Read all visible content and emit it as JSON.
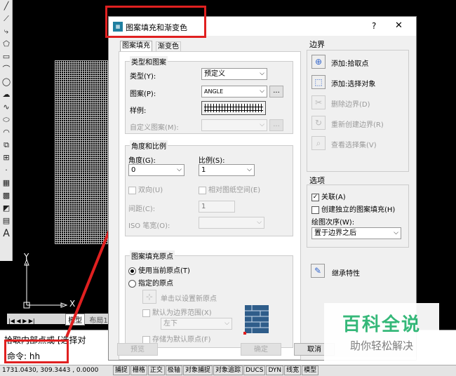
{
  "dialog": {
    "title": "图案填充和渐变色",
    "help": "?",
    "close": "✕",
    "tabs": [
      "图案填充",
      "渐变色"
    ],
    "type_group": {
      "title": "类型和图案",
      "type_label": "类型(Y):",
      "type_value": "预定义",
      "pattern_label": "图案(P):",
      "pattern_value": "ANGLE",
      "more": "...",
      "sample_label": "样例:",
      "custom_label": "自定义图案(M):"
    },
    "angle_group": {
      "title": "角度和比例",
      "angle_label": "角度(G):",
      "angle_value": "0",
      "scale_label": "比例(S):",
      "scale_value": "1",
      "double": "双向(U)",
      "relative": "相对图纸空间(E)",
      "spacing_label": "间距(C):",
      "spacing_value": "1",
      "iso_label": "ISO 笔宽(O):"
    },
    "origin_group": {
      "title": "图案填充原点",
      "use_current": "使用当前原点(T)",
      "specified": "指定的原点",
      "click_set": "单击以设置新原点",
      "default_extent": "默认为边界范围(X)",
      "position": "左下",
      "store_default": "存储为默认原点(F)"
    },
    "boundary": {
      "title": "边界",
      "add_pick": "添加:拾取点",
      "add_select": "添加:选择对象",
      "remove": "删除边界(D)",
      "recreate": "重新创建边界(R)",
      "view": "查看选择集(V)"
    },
    "options": {
      "title": "选项",
      "associative": "关联(A)",
      "independent": "创建独立的图案填充(H)",
      "draw_order_label": "绘图次序(W):",
      "draw_order_value": "置于边界之后",
      "inherit": "继承特性"
    },
    "buttons": {
      "preview": "预览",
      "ok": "确定",
      "cancel": "取消"
    }
  },
  "cad": {
    "ucs_x": "X",
    "ucs_y": "Y",
    "model_tab": "模型",
    "layout_tab": "布局1",
    "cmd_line1": "拾取内部点或 [选择对",
    "cmd_line2": "命令: hh",
    "coords": "1731.0430, 309.3443 , 0.0000",
    "status_items": [
      "捕捉",
      "栅格",
      "正交",
      "极轴",
      "对象捕捉",
      "对象追踪",
      "DUCS",
      "DYN",
      "线宽",
      "模型"
    ]
  },
  "watermark": {
    "title": "百科全说",
    "subtitle": "助你轻松解决"
  },
  "colors": {
    "annotation": "#e02020",
    "watermark_green": "#2bb673",
    "select_blue": "#0078d7"
  }
}
